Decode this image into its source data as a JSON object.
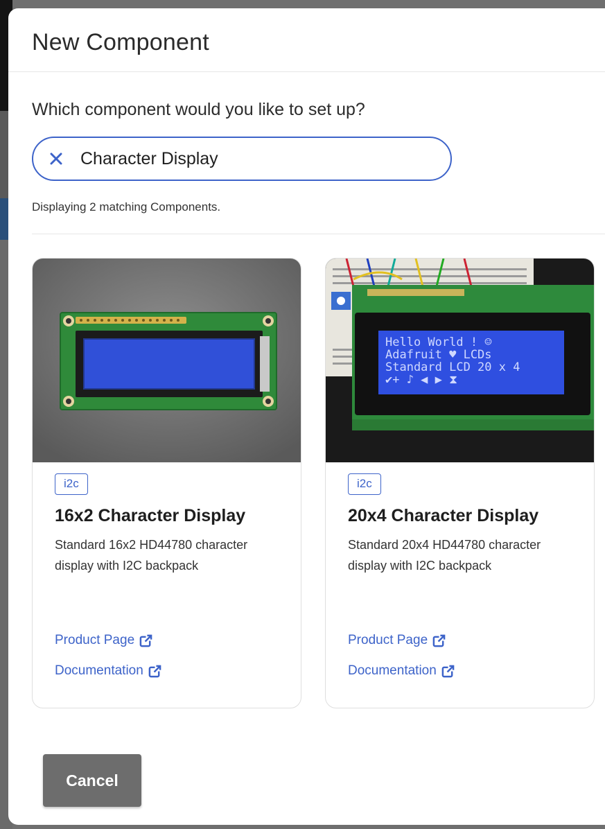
{
  "modal": {
    "title": "New Component"
  },
  "search": {
    "question": "Which component would you like to set up?",
    "value": "Character Display",
    "clear_icon": "close-icon",
    "result_text": "Displaying 2 matching Components."
  },
  "cards": [
    {
      "tag": "i2c",
      "title": "16x2 Character Display",
      "description": "Standard 16x2 HD44780 character display with I2C backpack",
      "product_link": "Product Page",
      "docs_link": "Documentation"
    },
    {
      "tag": "i2c",
      "title": "20x4 Character Display",
      "description": "Standard 20x4 HD44780 character display with I2C backpack",
      "product_link": "Product Page",
      "docs_link": "Documentation",
      "lcd_lines": [
        "Hello World ! ☺",
        "Adafruit ♥ LCDs",
        "Standard LCD 20 x 4",
        "✔+ ♪ ◀ ▶ ⧗"
      ]
    }
  ],
  "footer": {
    "cancel_label": "Cancel"
  },
  "colors": {
    "accent": "#3d63c9",
    "cancel_bg": "#6d6d6d",
    "lcd_blue": "#2f4fe0"
  }
}
